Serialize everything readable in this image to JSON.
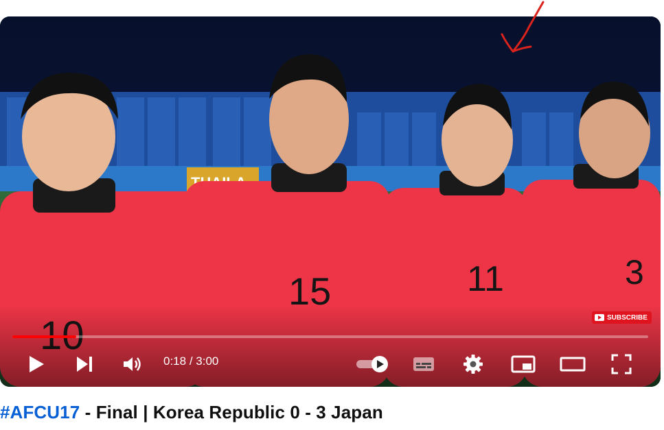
{
  "player": {
    "time_current": "0:18",
    "time_separator": " / ",
    "time_total": "3:00",
    "progress_fraction": 0.1,
    "subscribe_label": "SUBSCRIBE",
    "jersey_numbers": [
      "10",
      "15",
      "11",
      "3"
    ],
    "banner_text": "THAILA",
    "controls": {
      "play": "play-icon",
      "next": "next-icon",
      "volume": "volume-icon",
      "autoplay": "autoplay-toggle-icon",
      "captions": "captions-icon",
      "settings": "gear-icon",
      "miniplayer": "miniplayer-icon",
      "theater": "theater-mode-icon",
      "fullscreen": "fullscreen-icon"
    }
  },
  "video": {
    "hashtag": "#AFCU17",
    "title_rest": " - Final | Korea Republic 0 - 3 Japan"
  },
  "colors": {
    "accent_red": "#ff0000",
    "hashtag_blue": "#065fd4",
    "jersey_red": "#ee3547"
  }
}
